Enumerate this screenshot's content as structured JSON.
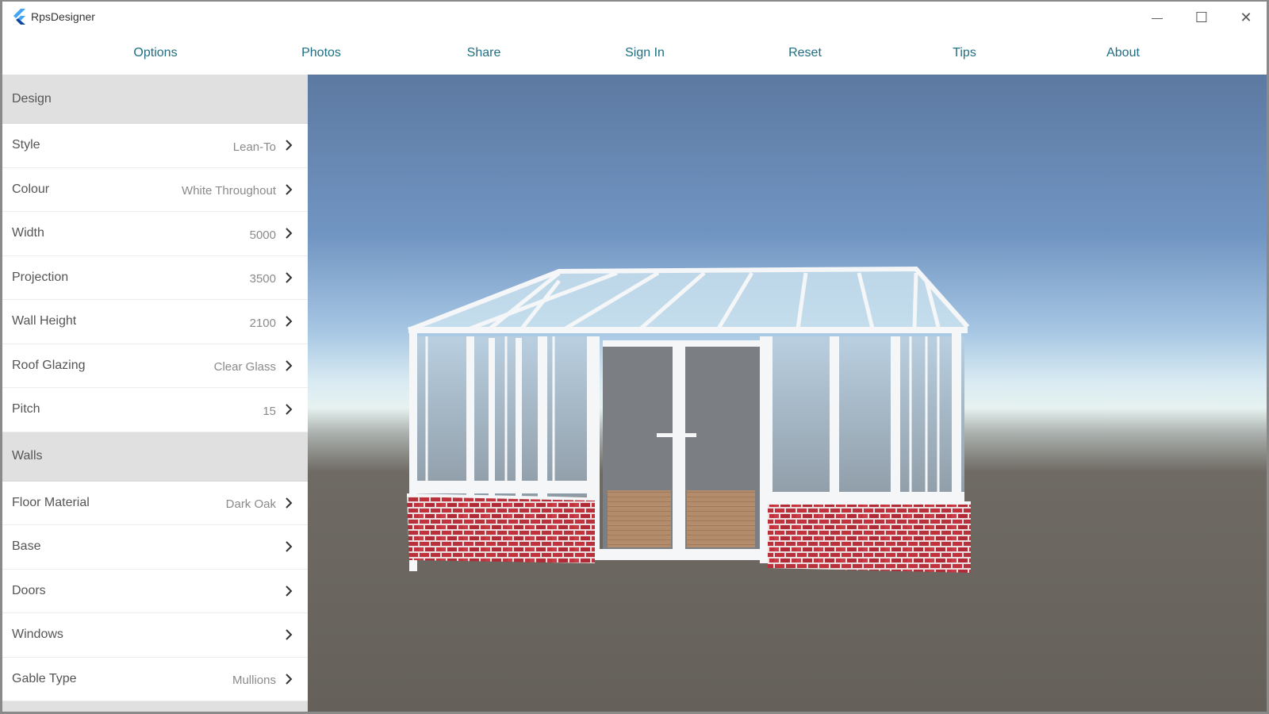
{
  "app": {
    "title": "RpsDesigner",
    "logo_icon": "flutter-logo-icon"
  },
  "window_controls": {
    "minimize": "—",
    "maximize": "☐",
    "close": "✕"
  },
  "nav": {
    "items": [
      "Options",
      "Photos",
      "Share",
      "Sign In",
      "Reset",
      "Tips",
      "About"
    ]
  },
  "sidebar": {
    "design": {
      "header": "Design",
      "rows": [
        {
          "label": "Style",
          "value": "Lean-To"
        },
        {
          "label": "Colour",
          "value": "White Throughout"
        },
        {
          "label": "Width",
          "value": "5000"
        },
        {
          "label": "Projection",
          "value": "3500"
        },
        {
          "label": "Wall Height",
          "value": "2100"
        },
        {
          "label": "Roof Glazing",
          "value": "Clear Glass"
        },
        {
          "label": "Pitch",
          "value": "15"
        }
      ]
    },
    "walls": {
      "header": "Walls",
      "rows": [
        {
          "label": "Floor Material",
          "value": "Dark Oak"
        },
        {
          "label": "Base",
          "value": ""
        },
        {
          "label": "Doors",
          "value": ""
        },
        {
          "label": "Windows",
          "value": ""
        },
        {
          "label": "Gable Type",
          "value": "Mullions"
        }
      ]
    }
  },
  "colors": {
    "nav_text": "#1f6e82",
    "section_header_bg": "#e0e0e0",
    "brick": "#b8303a",
    "frame": "#f4f6f8"
  }
}
